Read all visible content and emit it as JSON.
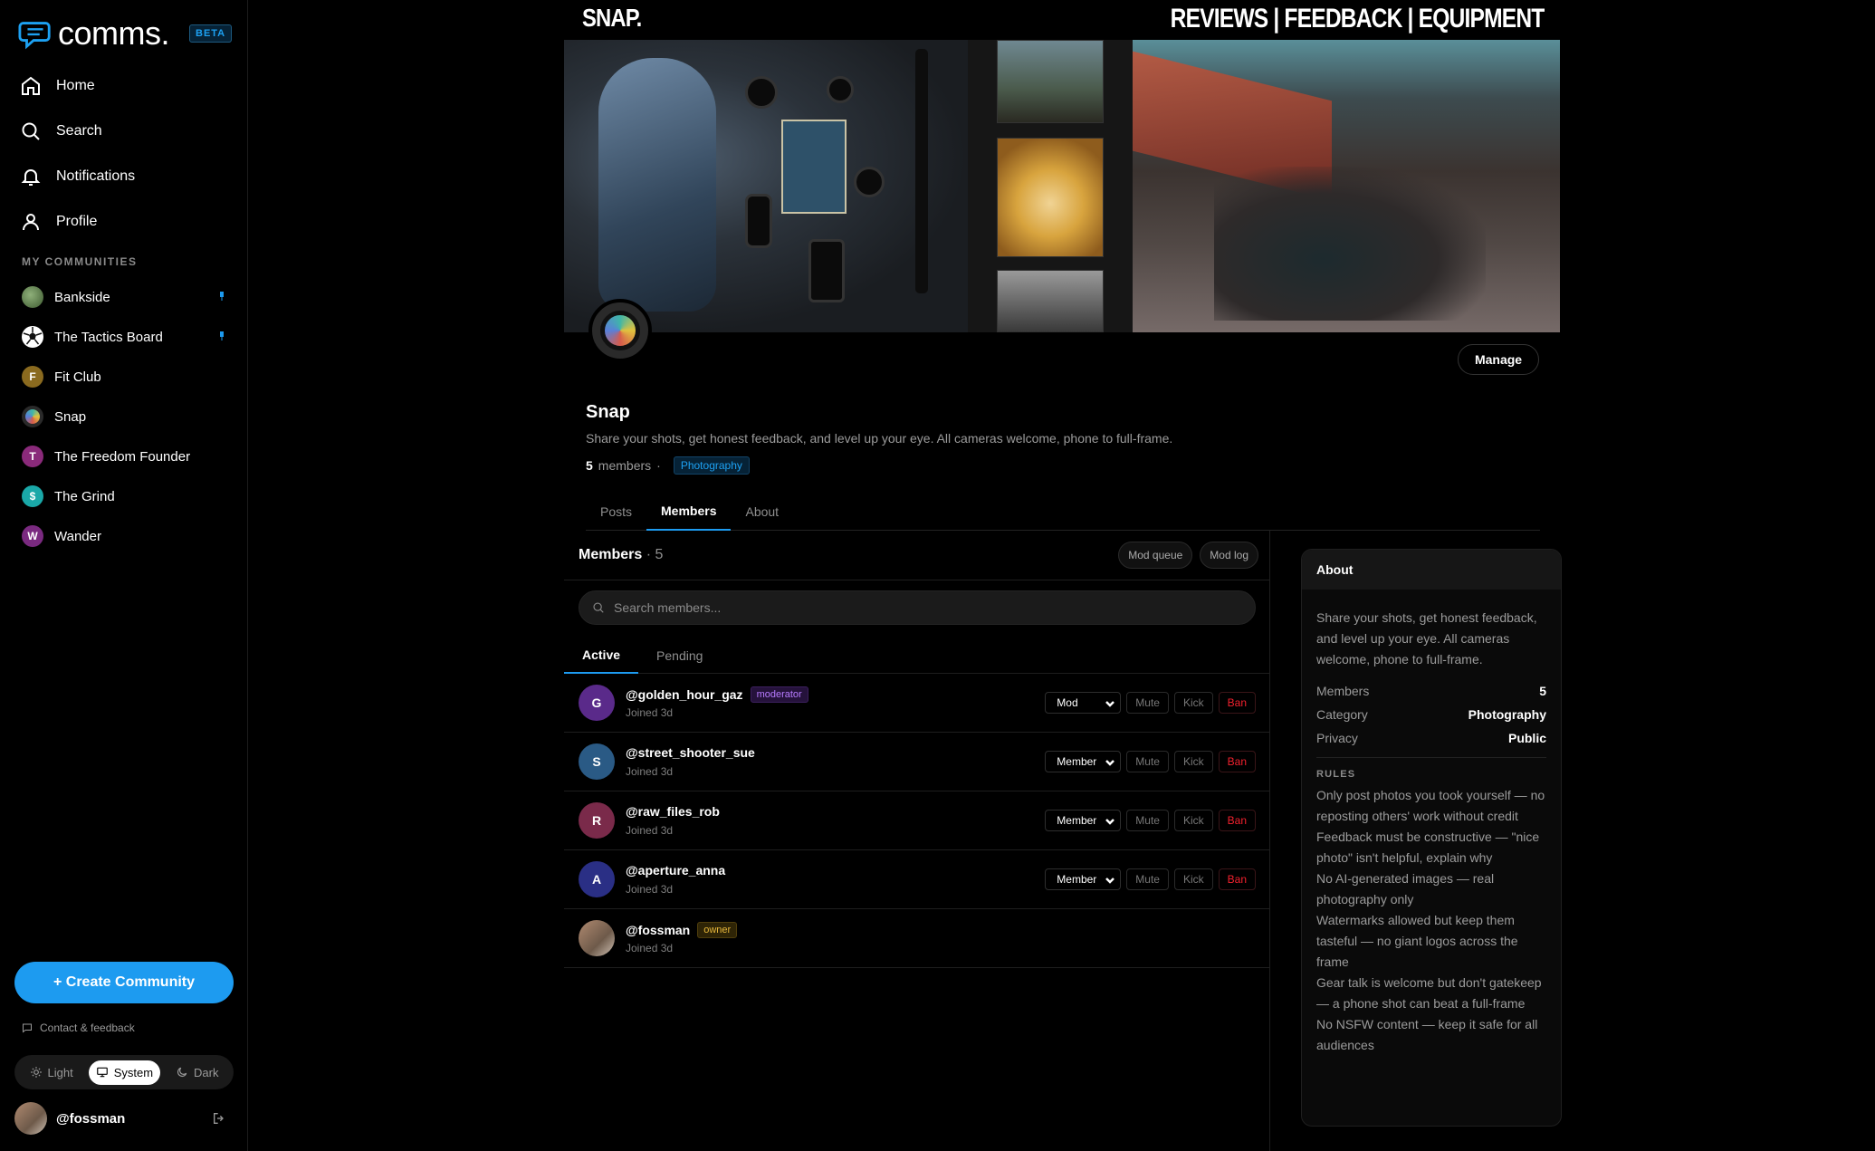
{
  "sidebar": {
    "brand": "comms.",
    "beta": "BETA",
    "nav": [
      {
        "label": "Home",
        "icon": "home-icon"
      },
      {
        "label": "Search",
        "icon": "search-icon"
      },
      {
        "label": "Notifications",
        "icon": "bell-icon"
      },
      {
        "label": "Profile",
        "icon": "user-icon"
      }
    ],
    "section_label": "MY COMMUNITIES",
    "communities": [
      {
        "name": "Bankside",
        "initial": "",
        "color": "#5b7d4a",
        "pinned": true
      },
      {
        "name": "The Tactics Board",
        "initial": "",
        "color": "#ffffff",
        "pinned": true
      },
      {
        "name": "Fit Club",
        "initial": "F",
        "color": "#8a6a1f",
        "pinned": false
      },
      {
        "name": "Snap",
        "initial": "",
        "color": "#2f3a3a",
        "pinned": false
      },
      {
        "name": "The Freedom Founder",
        "initial": "T",
        "color": "#8a2a7a",
        "pinned": false
      },
      {
        "name": "The Grind",
        "initial": "$",
        "color": "#1aa8a8",
        "pinned": false
      },
      {
        "name": "Wander",
        "initial": "W",
        "color": "#7a2a80",
        "pinned": false
      }
    ],
    "create_label": "+ Create Community",
    "contact_label": "Contact & feedback",
    "theme": {
      "light": "Light",
      "system": "System",
      "dark": "Dark",
      "active": "system"
    },
    "user": "@fossman"
  },
  "banner": {
    "left": "SNAP.",
    "right": "REVIEWS | FEEDBACK | EQUIPMENT"
  },
  "community": {
    "manage_label": "Manage",
    "title": "Snap",
    "description": "Share your shots, get honest feedback, and level up your eye. All cameras welcome, phone to full-frame.",
    "member_count": "5",
    "members_word": "members",
    "separator": "·",
    "category_tag": "Photography",
    "tabs": [
      "Posts",
      "Members",
      "About"
    ],
    "active_tab": "Members"
  },
  "members_panel": {
    "heading": "Members",
    "count": "· 5",
    "mod_queue": "Mod queue",
    "mod_log": "Mod log",
    "search_placeholder": "Search members...",
    "sub_tabs": [
      "Active",
      "Pending"
    ],
    "actions": {
      "mute": "Mute",
      "kick": "Kick",
      "ban": "Ban"
    },
    "members": [
      {
        "handle": "@golden_hour_gaz",
        "initial": "G",
        "color": "#5a2a8a",
        "badge": "moderator",
        "joined": "Joined 3d",
        "role": "Mod",
        "manageable": true
      },
      {
        "handle": "@street_shooter_sue",
        "initial": "S",
        "color": "#2a5a85",
        "badge": "",
        "joined": "Joined 3d",
        "role": "Member",
        "manageable": true
      },
      {
        "handle": "@raw_files_rob",
        "initial": "R",
        "color": "#7a2a4a",
        "badge": "",
        "joined": "Joined 3d",
        "role": "Member",
        "manageable": true
      },
      {
        "handle": "@aperture_anna",
        "initial": "A",
        "color": "#2a2f85",
        "badge": "",
        "joined": "Joined 3d",
        "role": "Member",
        "manageable": true
      },
      {
        "handle": "@fossman",
        "initial": "",
        "color": "#8d7563",
        "badge": "owner",
        "joined": "Joined 3d",
        "role": "",
        "manageable": false
      }
    ]
  },
  "about": {
    "heading": "About",
    "description": "Share your shots, get honest feedback, and level up your eye. All cameras welcome, phone to full-frame.",
    "stats": [
      {
        "label": "Members",
        "value": "5"
      },
      {
        "label": "Category",
        "value": "Photography"
      },
      {
        "label": "Privacy",
        "value": "Public"
      }
    ],
    "rules_label": "RULES",
    "rules": [
      "Only post photos you took yourself — no reposting others' work without credit",
      "Feedback must be constructive — \"nice photo\" isn't helpful, explain why",
      "No AI-generated images — real photography only",
      "Watermarks allowed but keep them tasteful — no giant logos across the frame",
      "Gear talk is welcome but don't gatekeep — a phone shot can beat a full-frame",
      "No NSFW content — keep it safe for all audiences"
    ]
  },
  "colors": {
    "accent": "#1d9bf0",
    "ban": "#f4212e",
    "moderator_badge": "#b77bff",
    "owner_badge": "#e6b73b"
  }
}
